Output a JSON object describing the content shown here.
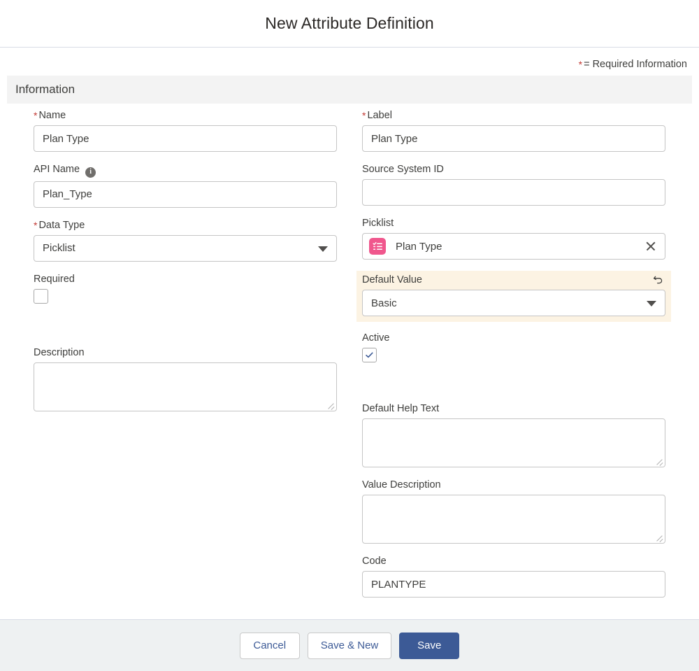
{
  "header": {
    "title": "New Attribute Definition"
  },
  "legend": {
    "star": "*",
    "text": "= Required Information"
  },
  "section": {
    "title": "Information"
  },
  "left_column": {
    "name": {
      "label": "Name",
      "required_star": "*",
      "value": "Plan Type",
      "placeholder": ""
    },
    "api_name": {
      "label": "API Name",
      "info_icon": "info-icon",
      "info_glyph": "i",
      "value": "Plan_Type",
      "placeholder": ""
    },
    "data_type": {
      "label": "Data Type",
      "required_star": "*",
      "value": "Picklist",
      "options": [
        "Picklist"
      ]
    },
    "required_checkbox": {
      "label": "Required",
      "checked": false
    },
    "description": {
      "label": "Description",
      "value": "",
      "placeholder": ""
    }
  },
  "right_column": {
    "label_field": {
      "label": "Label",
      "required_star": "*",
      "value": "Plan Type",
      "placeholder": ""
    },
    "source_system_id": {
      "label": "Source System ID",
      "value": "",
      "placeholder": ""
    },
    "picklist": {
      "label": "Picklist",
      "value": "Plan Type",
      "icon": "picklist-icon",
      "clear_icon": "close-icon"
    },
    "default_value": {
      "label": "Default Value",
      "value": "Basic",
      "options": [
        "Basic"
      ],
      "highlighted": true,
      "undo_icon": "undo-icon"
    },
    "active_checkbox": {
      "label": "Active",
      "checked": true
    },
    "default_help_text": {
      "label": "Default Help Text",
      "value": "",
      "placeholder": ""
    },
    "value_description": {
      "label": "Value Description",
      "value": "",
      "placeholder": ""
    },
    "code": {
      "label": "Code",
      "value": "PLANTYPE",
      "placeholder": ""
    }
  },
  "footer": {
    "cancel_label": "Cancel",
    "save_new_label": "Save & New",
    "save_label": "Save"
  },
  "colors": {
    "required_star": "#c23934",
    "brand_blue": "#3c5a96",
    "picklist_icon_pink": "#f0578d",
    "highlight_cream": "#fcf3e3",
    "section_band_gray": "#f3f3f3",
    "footer_gray": "#eef1f2",
    "checkbox_check_blue": "#3c5a96"
  }
}
